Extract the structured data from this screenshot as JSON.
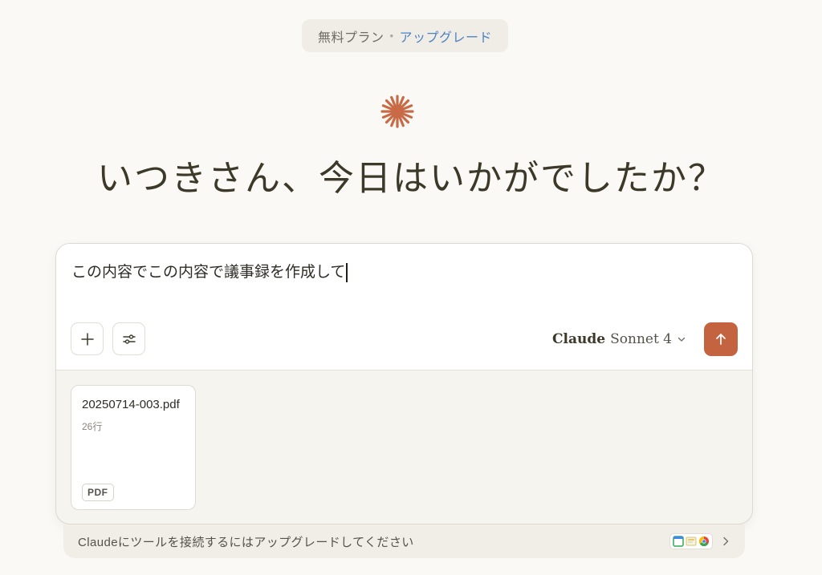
{
  "plan": {
    "label": "無料プラン",
    "separator": "•",
    "upgrade_link": "アップグレード"
  },
  "greeting": "いつきさん、今日はいかがでしたか？",
  "composer": {
    "input_value": "この内容でこの内容で議事録を作成して",
    "model": {
      "brand": "Claude",
      "name": "Sonnet 4"
    },
    "attachments": [
      {
        "file_name": "20250714-003.pdf",
        "meta": "26行",
        "type": "PDF"
      }
    ]
  },
  "connect_bar": {
    "text": "Claudeにツールを接続するにはアップグレードしてください",
    "icons": [
      "google-calendar-icon",
      "google-drive-icon",
      "chrome-icon"
    ]
  },
  "colors": {
    "accent": "#c4633f",
    "link": "#4f82c4",
    "background": "#faf9f5"
  }
}
